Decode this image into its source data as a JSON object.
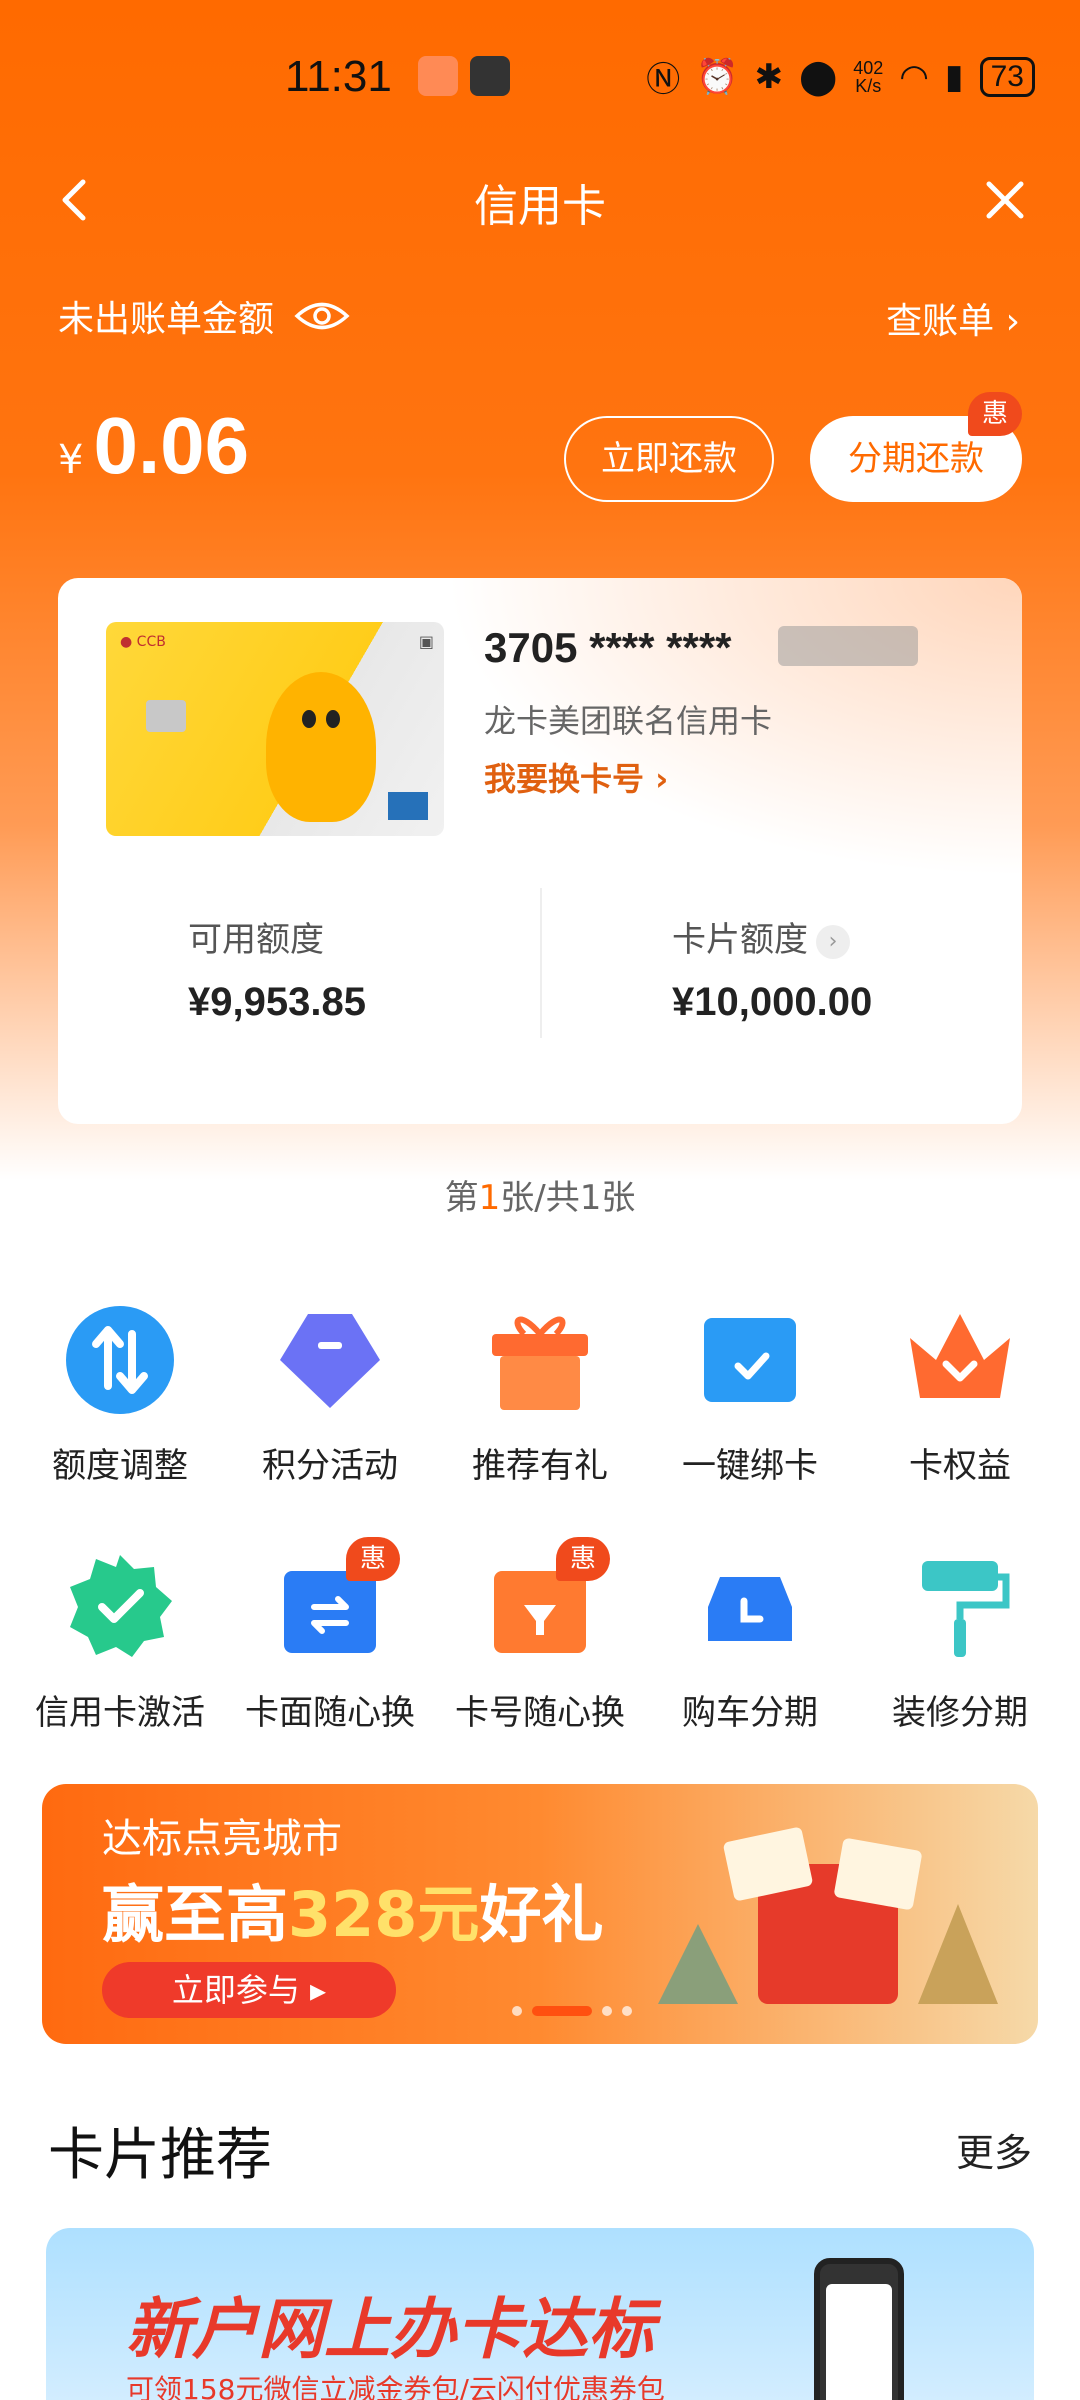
{
  "status_bar": {
    "time": "11:31",
    "net_speed_top": "402",
    "net_speed_unit": "K/s",
    "battery": "73"
  },
  "nav": {
    "title": "信用卡"
  },
  "summary": {
    "unbilled_label": "未出账单金额",
    "bill_link": "查账单",
    "currency": "¥",
    "amount": "0.06",
    "repay_button": "立即还款",
    "installment_button": "分期还款",
    "hui_badge": "惠"
  },
  "card": {
    "number": "3705 **** ****",
    "name": "龙卡美团联名信用卡",
    "change_number": "我要换卡号",
    "available_label": "可用额度",
    "available_value": "¥9,953.85",
    "limit_label": "卡片额度",
    "limit_value": "¥10,000.00"
  },
  "pager": {
    "prefix": "第",
    "current": "1",
    "suffix": "张/共1张"
  },
  "grid": [
    {
      "label": "额度调整",
      "icon": "adjust-icon"
    },
    {
      "label": "积分活动",
      "icon": "diamond-icon"
    },
    {
      "label": "推荐有礼",
      "icon": "gift-icon"
    },
    {
      "label": "一键绑卡",
      "icon": "bind-card-icon"
    },
    {
      "label": "卡权益",
      "icon": "crown-icon"
    },
    {
      "label": "信用卡激活",
      "icon": "activate-badge-icon"
    },
    {
      "label": "卡面随心换",
      "icon": "card-face-icon",
      "badge": "惠"
    },
    {
      "label": "卡号随心换",
      "icon": "card-number-icon",
      "badge": "惠"
    },
    {
      "label": "购车分期",
      "icon": "car-icon"
    },
    {
      "label": "装修分期",
      "icon": "paint-roller-icon"
    }
  ],
  "banner": {
    "line1": "达标点亮城市",
    "line2_prefix": "赢至高",
    "line2_num": "328元",
    "line2_suffix": "好礼",
    "join": "立即参与 ▸"
  },
  "recommend": {
    "title": "卡片推荐",
    "more": "更多"
  },
  "bottom_banner": {
    "title": "新户网上办卡达标",
    "subtitle": "可领158元微信立减金券包/云闪付优惠券包"
  },
  "colors": {
    "brand_orange": "#ff6a00",
    "badge_red": "#f04a1c"
  }
}
